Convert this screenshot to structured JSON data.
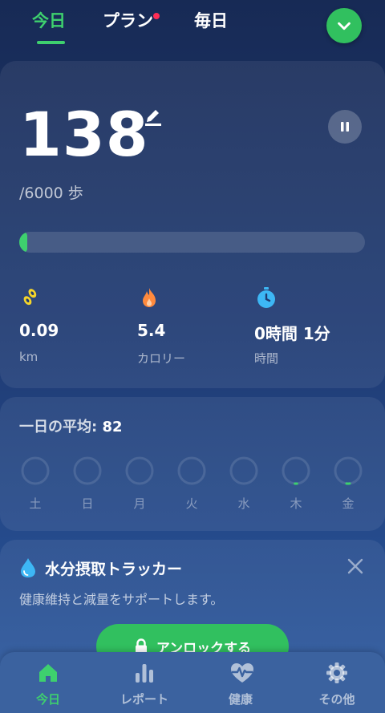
{
  "tabs": [
    {
      "label": "今日",
      "active": true
    },
    {
      "label": "プラン",
      "badge": true
    },
    {
      "label": "毎日"
    }
  ],
  "header_icons": {
    "dropdown": "chevron-down-icon"
  },
  "steps": {
    "value": "138",
    "goal": "/6000 歩",
    "progress": 0.023
  },
  "stats": [
    {
      "icon": "footsteps-icon",
      "value": "0.09",
      "label": "km"
    },
    {
      "icon": "flame-icon",
      "value": "5.4",
      "label": "カロリー"
    },
    {
      "icon": "stopwatch-icon",
      "value": "0時間 1分",
      "label": "時間"
    }
  ],
  "daily_avg": {
    "label": "一日の平均:",
    "value": "82",
    "days": [
      {
        "label": "土",
        "progress": 0
      },
      {
        "label": "日",
        "progress": 0
      },
      {
        "label": "月",
        "progress": 0
      },
      {
        "label": "火",
        "progress": 0
      },
      {
        "label": "水",
        "progress": 0
      },
      {
        "label": "木",
        "progress": 0.01
      },
      {
        "label": "金",
        "progress": 0.04
      }
    ]
  },
  "water": {
    "title": "水分摂取トラッカー",
    "description": "健康維持と減量をサポートします。",
    "unlock_label": "アンロックする"
  },
  "nav": [
    {
      "label": "今日",
      "icon": "home-icon",
      "active": true
    },
    {
      "label": "レポート",
      "icon": "bar-chart-icon"
    },
    {
      "label": "健康",
      "icon": "heartbeat-icon"
    },
    {
      "label": "その他",
      "icon": "gear-icon"
    }
  ],
  "colors": {
    "accent": "#3ed06e",
    "badge": "#ff2d55",
    "flame": "#ff8a3d",
    "footsteps": "#f5d52a",
    "stopwatch": "#3db7f5",
    "water": "#3db7f5"
  }
}
